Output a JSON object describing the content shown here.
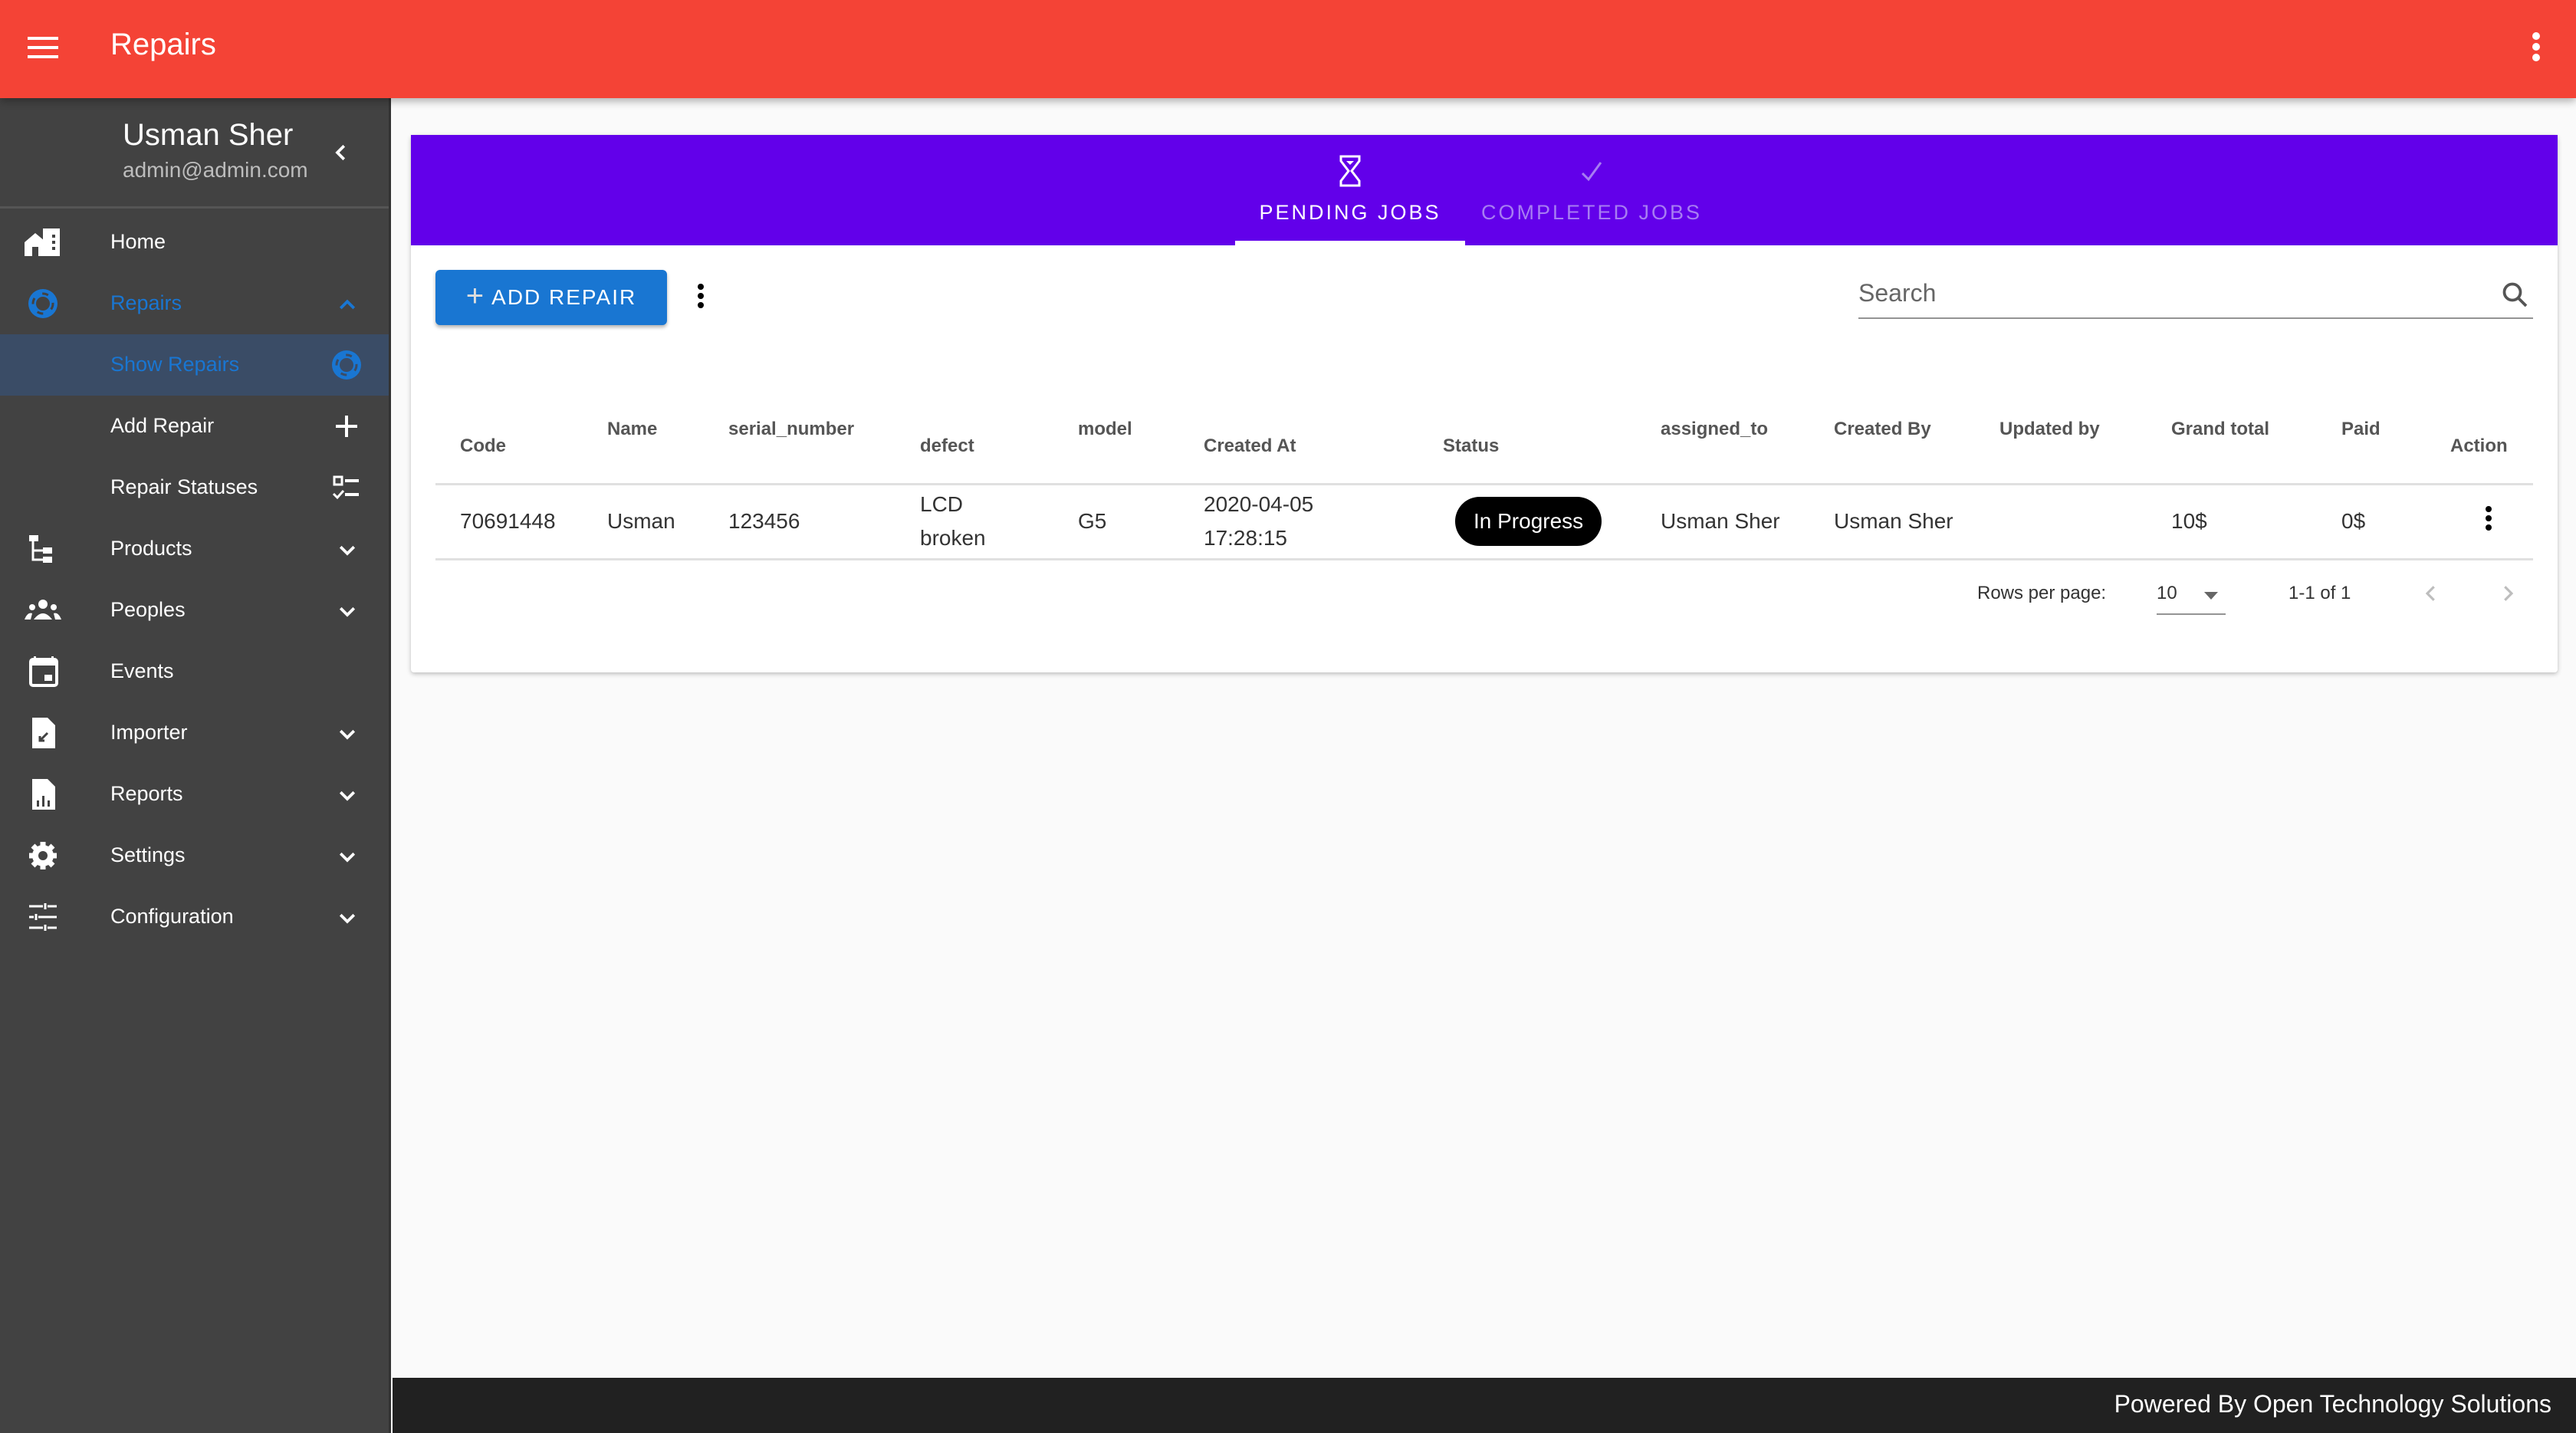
{
  "appbar": {
    "title": "Repairs",
    "menu_icon": "hamburger-icon",
    "more_icon": "more-vert-icon",
    "color": "#f44336"
  },
  "user": {
    "name": "Usman Sher",
    "email": "admin@admin.com"
  },
  "sidebar": {
    "items": [
      {
        "label": "Home",
        "icon": "home-city-icon"
      },
      {
        "label": "Repairs",
        "icon": "lifebuoy-icon",
        "expanded": true,
        "active": true
      },
      {
        "label": "Show Repairs",
        "icon": "lifebuoy-icon",
        "selected": true
      },
      {
        "label": "Add Repair",
        "icon": "plus-icon"
      },
      {
        "label": "Repair Statuses",
        "icon": "checklist-icon"
      },
      {
        "label": "Products",
        "icon": "file-tree-icon"
      },
      {
        "label": "Peoples",
        "icon": "people-icon"
      },
      {
        "label": "Events",
        "icon": "calendar-icon"
      },
      {
        "label": "Importer",
        "icon": "file-import-icon"
      },
      {
        "label": "Reports",
        "icon": "file-chart-icon"
      },
      {
        "label": "Settings",
        "icon": "gear-icon"
      },
      {
        "label": "Configuration",
        "icon": "tune-icon"
      }
    ]
  },
  "tabs": [
    {
      "label": "PENDING JOBS",
      "icon": "hourglass-icon",
      "active": true
    },
    {
      "label": "COMPLETED JOBS",
      "icon": "check-icon",
      "active": false
    }
  ],
  "toolbar": {
    "add_label": "ADD REPAIR",
    "search_placeholder": "Search"
  },
  "table": {
    "columns": [
      "Code",
      "Name",
      "serial_number",
      "defect",
      "model",
      "Created At",
      "Status",
      "assigned_to",
      "Created By",
      "Updated by",
      "Grand total",
      "Paid",
      "Action"
    ],
    "rows": [
      {
        "code": "70691448",
        "name": "Usman",
        "serial_number": "123456",
        "defect_line1": "LCD",
        "defect_line2": "broken",
        "model": "G5",
        "created_date": "2020-04-05",
        "created_time": "17:28:15",
        "status": "In Progress",
        "assigned_to": "Usman Sher",
        "created_by": "Usman Sher",
        "updated_by": "",
        "grand_total": "10$",
        "paid": "0$"
      }
    ]
  },
  "pagination": {
    "rows_per_page_label": "Rows per page:",
    "rows_per_page": "10",
    "range": "1-1 of 1"
  },
  "footer": {
    "text": "Powered By Open Technology Solutions"
  },
  "colors": {
    "tabbar": "#6200ea",
    "primary": "#1976d2",
    "sidebar": "#424242"
  }
}
